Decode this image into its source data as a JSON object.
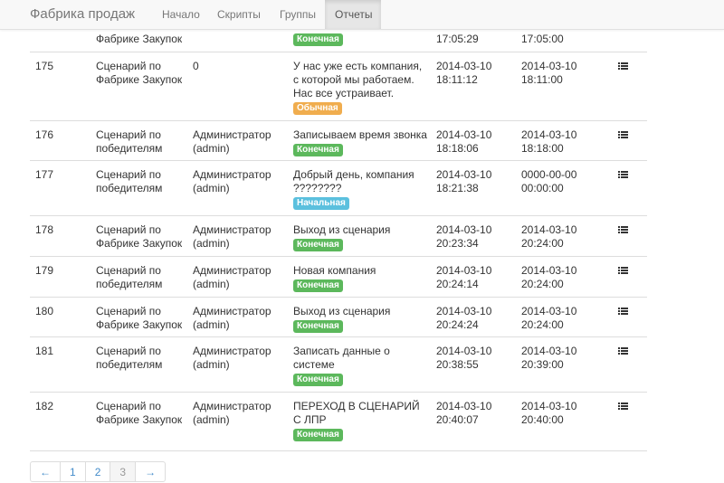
{
  "navbar": {
    "brand": "Фабрика продаж",
    "items": [
      {
        "label": "Начало"
      },
      {
        "label": "Скрипты"
      },
      {
        "label": "Группы"
      },
      {
        "label": "Отчеты"
      }
    ]
  },
  "table": {
    "partial_row": {
      "scenario_line2": "Фабрике Закупок",
      "badge": "Конечная",
      "start_time": "17:05:29",
      "end_time": "17:05:00"
    },
    "rows": [
      {
        "id": "175",
        "scenario": "Сценарий по Фабрике Закупок",
        "user": "0",
        "step": "У нас уже есть компания, с которой мы работаем. Нас все устраивает.",
        "badge": "Обычная",
        "badge_type": "normal",
        "start_date": "2014-03-10",
        "start_time": "18:11:12",
        "end_date": "2014-03-10",
        "end_time": "18:11:00"
      },
      {
        "id": "176",
        "scenario": "Сценарий по победителям",
        "user": "Администратор (admin)",
        "step": "Записываем время звонка",
        "badge": "Конечная",
        "badge_type": "final",
        "start_date": "2014-03-10",
        "start_time": "18:18:06",
        "end_date": "2014-03-10",
        "end_time": "18:18:00"
      },
      {
        "id": "177",
        "scenario": "Сценарий по победителям",
        "user": "Администратор (admin)",
        "step": "Добрый день, компания ????????",
        "badge": "Начальная",
        "badge_type": "initial",
        "start_date": "2014-03-10",
        "start_time": "18:21:38",
        "end_date": "0000-00-00",
        "end_time": "00:00:00"
      },
      {
        "id": "178",
        "scenario": "Сценарий по Фабрике Закупок",
        "user": "Администратор (admin)",
        "step": "Выход из сценария",
        "badge": "Конечная",
        "badge_type": "final",
        "start_date": "2014-03-10",
        "start_time": "20:23:34",
        "end_date": "2014-03-10",
        "end_time": "20:24:00"
      },
      {
        "id": "179",
        "scenario": "Сценарий по победителям",
        "user": "Администратор (admin)",
        "step": "Новая компания",
        "badge": "Конечная",
        "badge_type": "final",
        "start_date": "2014-03-10",
        "start_time": "20:24:14",
        "end_date": "2014-03-10",
        "end_time": "20:24:00"
      },
      {
        "id": "180",
        "scenario": "Сценарий по Фабрике Закупок",
        "user": "Администратор (admin)",
        "step": "Выход из сценария",
        "badge": "Конечная",
        "badge_type": "final",
        "start_date": "2014-03-10",
        "start_time": "20:24:24",
        "end_date": "2014-03-10",
        "end_time": "20:24:00"
      },
      {
        "id": "181",
        "scenario": "Сценарий по победителям",
        "user": "Администратор (admin)",
        "step": "Записать данные о системе",
        "badge": "Конечная",
        "badge_type": "final",
        "start_date": "2014-03-10",
        "start_time": "20:38:55",
        "end_date": "2014-03-10",
        "end_time": "20:39:00"
      },
      {
        "id": "182",
        "scenario": "Сценарий по Фабрике Закупок",
        "user": "Администратор (admin)",
        "step": "ПЕРЕХОД В СЦЕНАРИЙ С ЛПР",
        "badge": "Конечная",
        "badge_type": "final",
        "start_date": "2014-03-10",
        "start_time": "20:40:07",
        "end_date": "2014-03-10",
        "end_time": "20:40:00"
      }
    ]
  },
  "pagination": {
    "prev": "←",
    "pages": [
      "1",
      "2",
      "3"
    ],
    "current": "3",
    "next": "→"
  },
  "colors": {
    "badge_final": "#5cb85c",
    "badge_normal": "#f0ad4e",
    "badge_initial": "#5bc0de",
    "link": "#428bca"
  },
  "icons": {
    "row_action": "list-icon"
  }
}
